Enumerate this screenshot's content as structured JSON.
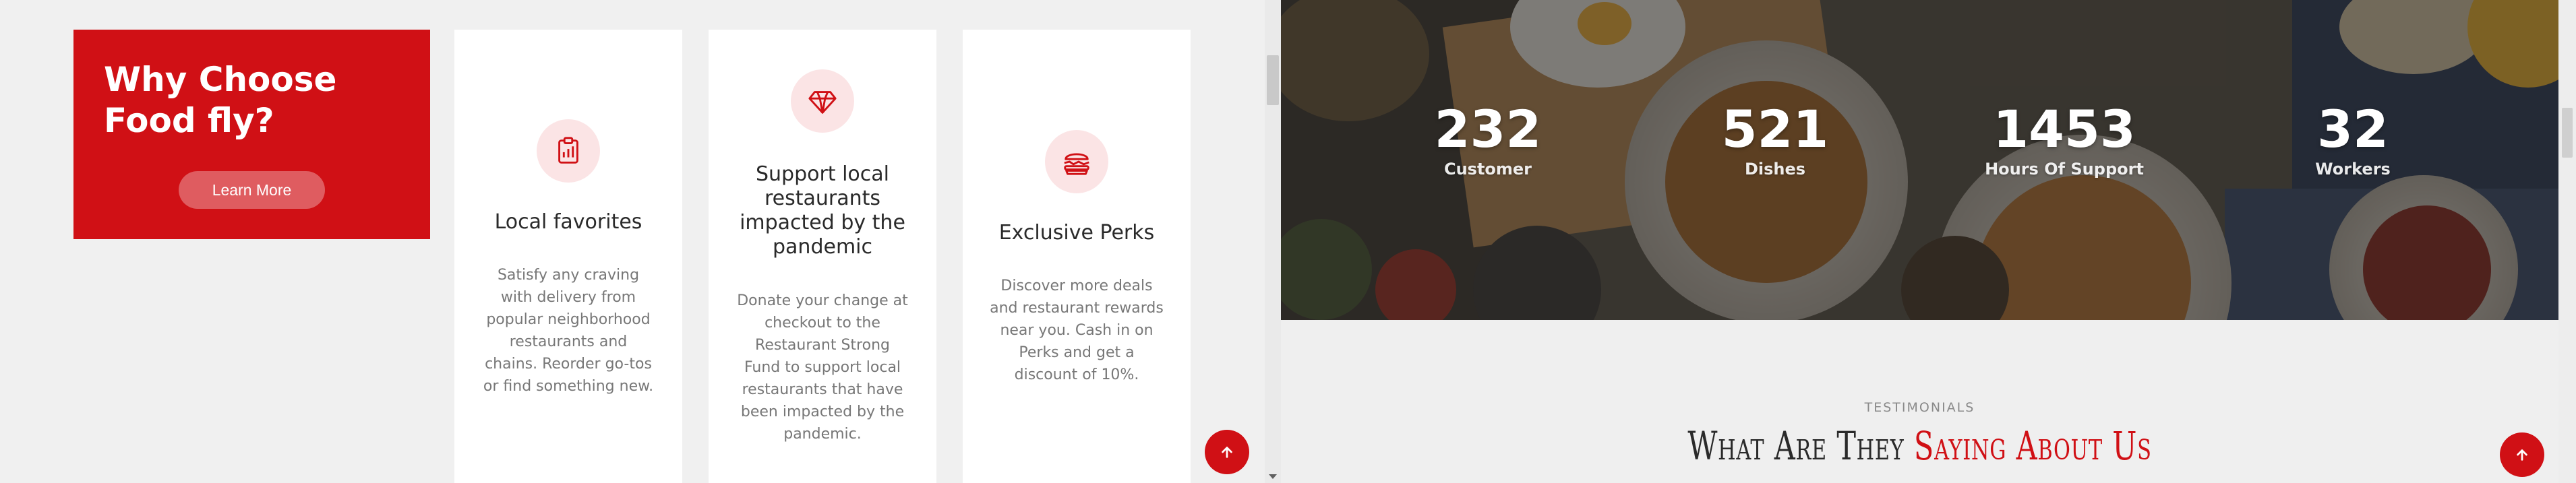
{
  "left": {
    "why": {
      "title": "Why Choose Food fly?",
      "button_label": "Learn More"
    },
    "features": [
      {
        "icon": "clipboard-chart-icon",
        "title": "Local favorites",
        "text": "Satisfy any craving with delivery from popular neighborhood restaurants and chains. Reorder go-tos or find something new."
      },
      {
        "icon": "diamond-icon",
        "title": "Support local restaurants impacted by the pandemic",
        "text": "Donate your change at checkout to the Restaurant Strong Fund to support local restaurants that have been impacted by the pandemic."
      },
      {
        "icon": "burger-icon",
        "title": "Exclusive Perks",
        "text": "Discover more deals and restaurant rewards near you. Cash in on Perks and get a discount of 10%."
      }
    ]
  },
  "right": {
    "stats": [
      {
        "value": "232",
        "label": "Customer"
      },
      {
        "value": "521",
        "label": "Dishes"
      },
      {
        "value": "1453",
        "label": "Hours Of Support"
      },
      {
        "value": "32",
        "label": "Workers"
      }
    ],
    "testimonials": {
      "eyebrow": "TESTIMONIALS",
      "heading_plain": "What Are They ",
      "heading_accent": "Saying About Us"
    }
  },
  "colors": {
    "brand_red": "#d01015",
    "icon_tint": "#fbe4e5",
    "page_gray": "#f0f0f0"
  }
}
